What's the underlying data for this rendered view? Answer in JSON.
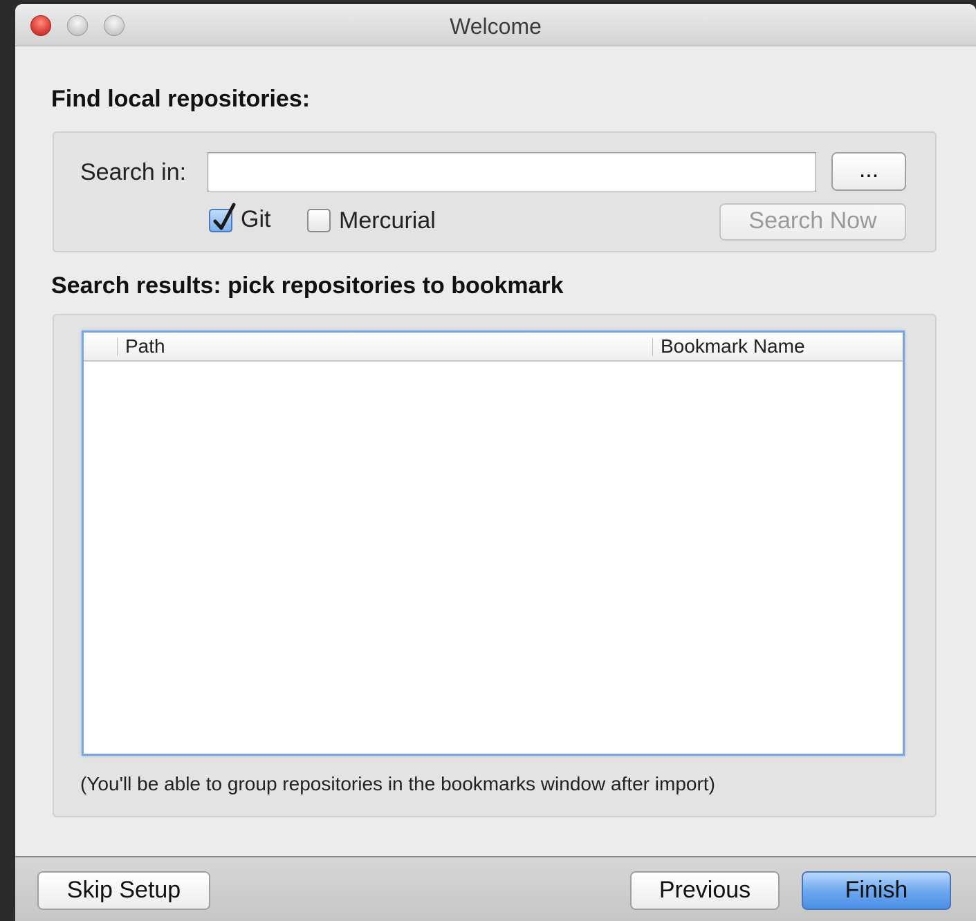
{
  "window": {
    "title": "Welcome"
  },
  "find_section": {
    "heading": "Find local repositories:",
    "search_label": "Search in:",
    "search_value": "",
    "browse_label": "...",
    "git_label": "Git",
    "git_checked": true,
    "mercurial_label": "Mercurial",
    "mercurial_checked": false,
    "search_now_label": "Search Now"
  },
  "results_section": {
    "heading": "Search results: pick repositories to bookmark",
    "columns": [
      "Path",
      "Bookmark Name"
    ],
    "rows": [],
    "note": "(You'll be able to group repositories in the bookmarks window after import)"
  },
  "footer": {
    "skip_label": "Skip Setup",
    "previous_label": "Previous",
    "finish_label": "Finish"
  },
  "colors": {
    "accent": "#6ea9ef",
    "close_button": "#e0443e",
    "table_focus": "#7aa5dc"
  },
  "icons": {
    "close": "close-icon",
    "minimize": "minimize-icon",
    "zoom": "zoom-icon",
    "check": "checkmark-icon"
  }
}
